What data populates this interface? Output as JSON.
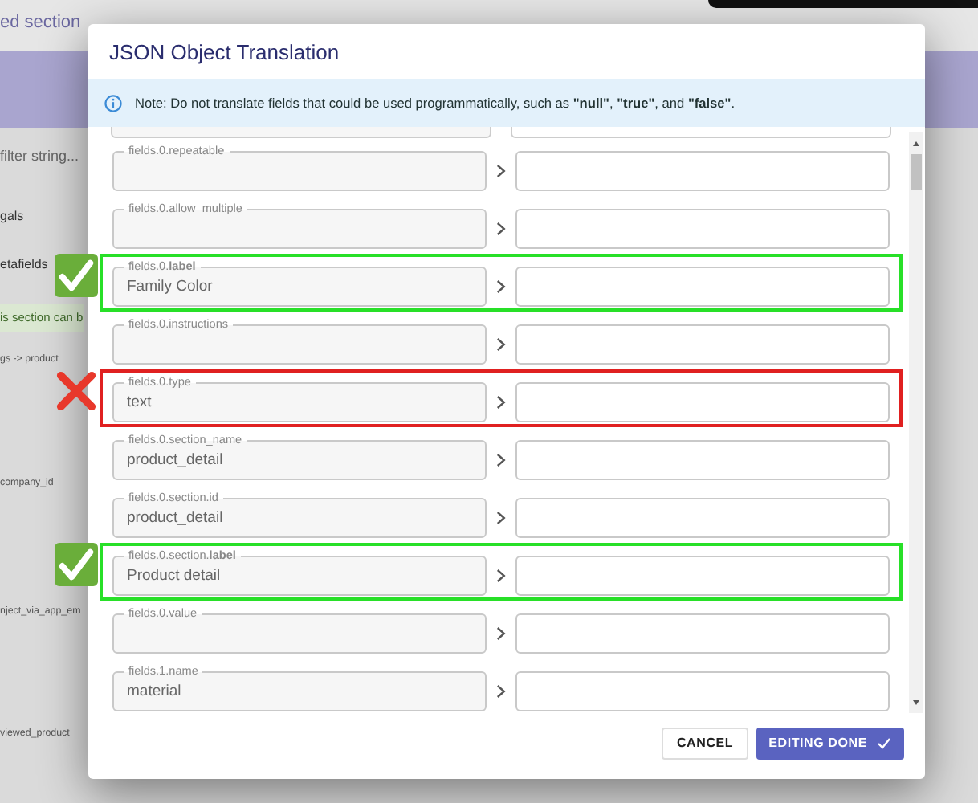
{
  "background": {
    "texts": [
      {
        "text": "ed section",
        "kind": "title"
      },
      {
        "text": "filter string...",
        "kind": "placeholder"
      },
      {
        "text": "gals",
        "kind": "item"
      },
      {
        "text": "etafields",
        "kind": "item"
      },
      {
        "text": "is section can b",
        "kind": "notice"
      },
      {
        "text": "gs -> product",
        "kind": "small"
      },
      {
        "text": "company_id",
        "kind": "small"
      },
      {
        "text": "nject_via_app_em",
        "kind": "small"
      },
      {
        "text": "viewed_product",
        "kind": "small"
      }
    ]
  },
  "dialog": {
    "title": "JSON Object Translation",
    "note": "Note: Do not translate fields that could be used programmatically, such as **\"null\"**, **\"true\"**, and **\"false\"**.",
    "rows": [
      {
        "label": "fields.0.repeatable",
        "kind": "plain"
      },
      {
        "label": "fields.0.allow_multiple",
        "kind": "plain"
      },
      {
        "label": "fields.0.**label**",
        "value": "Family Color",
        "kind": "approved"
      },
      {
        "label": "fields.0.instructions",
        "kind": "plain"
      },
      {
        "label": "fields.0.type",
        "value": "text",
        "kind": "rejected"
      },
      {
        "label": "fields.0.section_name",
        "value": "product_detail",
        "kind": "plain"
      },
      {
        "label": "fields.0.section.id",
        "value": "product_detail",
        "kind": "plain"
      },
      {
        "label": "fields.0.section.**label**",
        "value": "Product detail",
        "kind": "approved"
      },
      {
        "label": "fields.0.value",
        "kind": "plain"
      },
      {
        "label": "fields.1.name",
        "value": "material",
        "kind": "plain"
      }
    ],
    "buttons": [
      {
        "label": "CANCEL",
        "kind": "secondary"
      },
      {
        "label": "EDITING DONE",
        "kind": "primary"
      }
    ]
  }
}
